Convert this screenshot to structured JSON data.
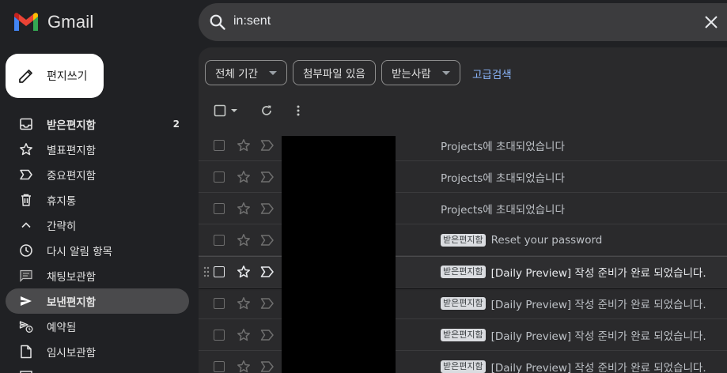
{
  "brand": {
    "name": "Gmail"
  },
  "compose": {
    "label": "편지쓰기",
    "icon": "pencil-icon"
  },
  "nav": [
    {
      "name": "inbox",
      "label": "받은편지함",
      "count": "2",
      "icon": "inbox-icon",
      "bold": true
    },
    {
      "name": "starred",
      "label": "별표편지함",
      "icon": "star-icon"
    },
    {
      "name": "important",
      "label": "중요편지함",
      "icon": "label-important-icon"
    },
    {
      "name": "trash",
      "label": "휴지통",
      "icon": "trash-icon"
    },
    {
      "name": "less",
      "label": "간략히",
      "icon": "chevron-up-icon"
    },
    {
      "name": "snoozed",
      "label": "다시 알림 항목",
      "icon": "clock-icon"
    },
    {
      "name": "chats",
      "label": "채팅보관함",
      "icon": "chat-icon"
    },
    {
      "name": "sent",
      "label": "보낸편지함",
      "icon": "send-icon",
      "active": true
    },
    {
      "name": "scheduled",
      "label": "예약됨",
      "icon": "scheduled-send-icon"
    },
    {
      "name": "drafts",
      "label": "임시보관함",
      "icon": "draft-icon"
    }
  ],
  "search": {
    "query": "in:sent",
    "icon": "search-icon",
    "clear_icon": "close-icon"
  },
  "filters": {
    "date": "전체 기간",
    "attachment": "첨부파일 있음",
    "recipient": "받는사람",
    "advanced": "고급검색"
  },
  "toolbar": {
    "select_icon": "checkbox-icon",
    "refresh_icon": "refresh-icon",
    "more_icon": "more-vert-icon"
  },
  "emails": [
    {
      "label": "",
      "subject": "Projects에 초대되었습니다"
    },
    {
      "label": "",
      "subject": "Projects에 초대되었습니다"
    },
    {
      "label": "",
      "subject": "Projects에 초대되었습니다"
    },
    {
      "label": "받은편지함",
      "subject": "Reset your password"
    },
    {
      "label": "받은편지함",
      "subject": "[Daily Preview] 작성 준비가 완료 되었습니다.",
      "hover": true
    },
    {
      "label": "받은편지함",
      "subject": "[Daily Preview] 작성 준비가 완료 되었습니다."
    },
    {
      "label": "받은편지함",
      "subject": "[Daily Preview] 작성 준비가 완료 되었습니다."
    },
    {
      "label": "받은편지함",
      "subject": "[Daily Preview] 작성 준비가 완료 되었습니다."
    }
  ],
  "colors": {
    "background": "#202124",
    "panel": "#2a2a2c",
    "accent_link": "#8ab4f8",
    "active_nav": "#4a4a4c"
  }
}
